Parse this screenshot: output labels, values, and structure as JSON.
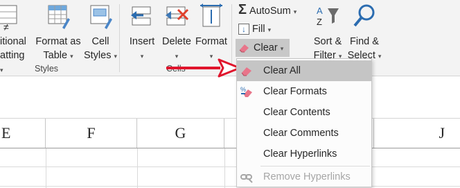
{
  "ribbon": {
    "conditional": {
      "line1": "itional",
      "line2": "atting"
    },
    "format_as_table": {
      "line1": "Format as",
      "line2": "Table"
    },
    "cell_styles": {
      "line1": "Cell",
      "line2": "Styles"
    },
    "styles_group_label": "Styles",
    "insert": "Insert",
    "delete": "Delete",
    "format": "Format",
    "cells_group_label": "Cells",
    "autosum": "AutoSum",
    "fill": "Fill",
    "clear": "Clear",
    "sort_filter": {
      "line1": "Sort &",
      "line2": "Filter"
    },
    "find_select": {
      "line1": "Find &",
      "line2": "Select"
    },
    "caret": "▾"
  },
  "columns": [
    "E",
    "F",
    "G",
    "J"
  ],
  "clear_menu": {
    "items": [
      {
        "label": "Clear All",
        "icon": "eraser-icon",
        "highlighted": true,
        "disabled": false
      },
      {
        "label": "Clear Formats",
        "icon": "clear-formats-icon",
        "highlighted": false,
        "disabled": false
      },
      {
        "label": "Clear Contents",
        "icon": "",
        "highlighted": false,
        "disabled": false
      },
      {
        "label": "Clear Comments",
        "icon": "",
        "highlighted": false,
        "disabled": false
      },
      {
        "label": "Clear Hyperlinks",
        "icon": "",
        "highlighted": false,
        "disabled": false
      },
      {
        "label": "Remove Hyperlinks",
        "icon": "remove-hyperlink-icon",
        "highlighted": false,
        "disabled": true
      }
    ]
  },
  "colors": {
    "accent_blue": "#2b6cb0",
    "eraser_pink": "#e8758a",
    "arrow_red": "#e0142c",
    "red_x": "#e0402c"
  }
}
